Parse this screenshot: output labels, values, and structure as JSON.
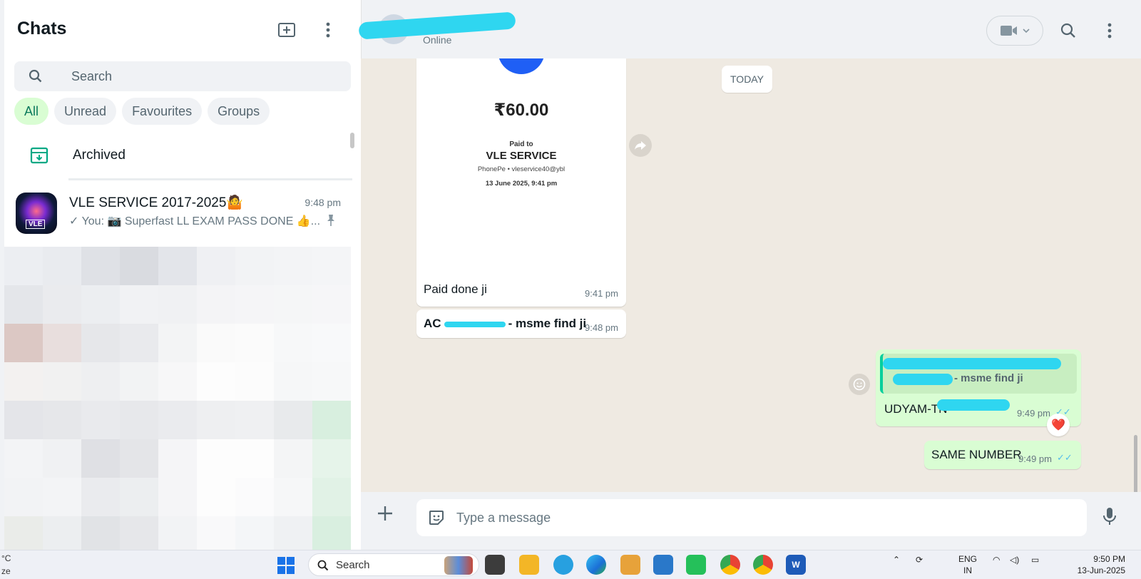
{
  "sidebar": {
    "title": "Chats",
    "search_placeholder": "Search",
    "filters": [
      "All",
      "Unread",
      "Favourites",
      "Groups"
    ],
    "archived_label": "Archived",
    "chats": [
      {
        "name": "VLE SERVICE 2017-2025🤷",
        "time": "9:48 pm",
        "last_message": "✓ You: 📷 Superfast LL EXAM PASS DONE 👍...",
        "avatar_text": "VLE",
        "pinned": true
      }
    ]
  },
  "conversation": {
    "contact_status": "Online",
    "date_divider": "TODAY",
    "payment_card": {
      "amount": "₹60.00",
      "paid_to_label": "Paid to",
      "payee": "VLE SERVICE",
      "upi": "PhonePe • vleservice40@ybl",
      "date": "13 June 2025, 9:41 pm",
      "caption": "Paid done ji",
      "time": "9:41 pm"
    },
    "incoming_msg": {
      "text_prefix": "AC",
      "text_suffix": "- msme find ji",
      "time": "9:48 pm"
    },
    "reply_msg": {
      "quoted_text": "- msme find ji",
      "text": "UDYAM-TN-",
      "time": "9:49 pm",
      "reaction": "❤️"
    },
    "outgoing_msg": {
      "text": "SAME NUMBER",
      "time": "9:49 pm"
    },
    "composer_placeholder": "Type a message"
  },
  "taskbar": {
    "search_label": "Search",
    "weather_line1": "°C",
    "weather_line2": "ze",
    "lang_line1": "ENG",
    "lang_line2": "IN",
    "time": "9:50 PM",
    "date": "13-Jun-2025"
  },
  "colors": {
    "accent": "#00a884",
    "outgoing_bubble": "#d9fdd3",
    "read_ticks": "#53bdeb",
    "redaction": "#2fd6f0"
  }
}
